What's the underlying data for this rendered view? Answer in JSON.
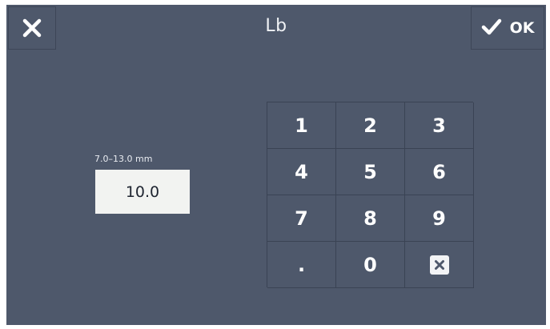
{
  "header": {
    "title": "Lb",
    "close_icon": "close-icon",
    "ok_icon": "checkmark-icon",
    "ok_label": "OK"
  },
  "input": {
    "range_label": "7.0–13.0 mm",
    "value": "10.0"
  },
  "keypad": {
    "keys": [
      "1",
      "2",
      "3",
      "4",
      "5",
      "6",
      "7",
      "8",
      "9",
      ".",
      "0"
    ],
    "backspace_icon": "backspace-icon"
  },
  "colors": {
    "background": "#4e586b",
    "field_background": "#f2f3f1",
    "text": "#ffffff",
    "grid_lines": "#3a4354"
  }
}
